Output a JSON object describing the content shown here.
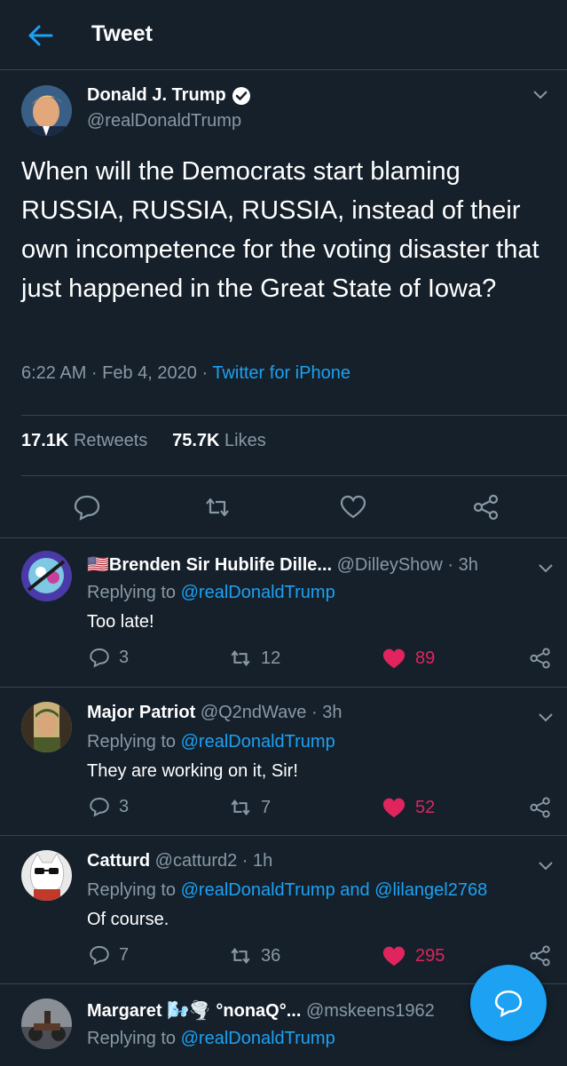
{
  "header": {
    "title": "Tweet"
  },
  "tweet": {
    "author_name": "Donald J. Trump",
    "author_handle": "@realDonaldTrump",
    "text": "When will the Democrats start blaming RUSSIA, RUSSIA, RUSSIA, instead of their own incompetence for the voting disaster that just happened in the Great State of Iowa?",
    "time": "6:22 AM · Feb 4, 2020 · ",
    "source": "Twitter for iPhone",
    "retweets_count": "17.1K",
    "retweets_label": "Retweets",
    "likes_count": "75.7K",
    "likes_label": "Likes"
  },
  "replies": [
    {
      "name": "🇺🇸Brenden Sir Hublife Dille...",
      "handle": "@DilleyShow · 3h",
      "replying_prefix": "Replying to ",
      "replying_to": "@realDonaldTrump",
      "text": "Too late!",
      "reply_count": "3",
      "retweet_count": "12",
      "like_count": "89"
    },
    {
      "name": "Major Patriot",
      "handle": "@Q2ndWave · 3h",
      "replying_prefix": "Replying to ",
      "replying_to": "@realDonaldTrump",
      "text": "They are working on it, Sir!",
      "reply_count": "3",
      "retweet_count": "7",
      "like_count": "52"
    },
    {
      "name": "Catturd",
      "handle": "@catturd2 · 1h",
      "replying_prefix": "Replying to ",
      "replying_to": "@realDonaldTrump and @lilangel2768",
      "text": "Of course.",
      "reply_count": "7",
      "retweet_count": "36",
      "like_count": "295"
    },
    {
      "name": "Margaret 🌬️🌪️ °nonaQ°...",
      "handle": "@mskeens1962",
      "replying_prefix": "Replying to ",
      "replying_to": "@realDonaldTrump",
      "text": ""
    }
  ],
  "colors": {
    "background": "#15202b",
    "accent": "#1da1f2",
    "muted": "#8899a6",
    "like": "#e0245e",
    "divider": "#38444d"
  }
}
